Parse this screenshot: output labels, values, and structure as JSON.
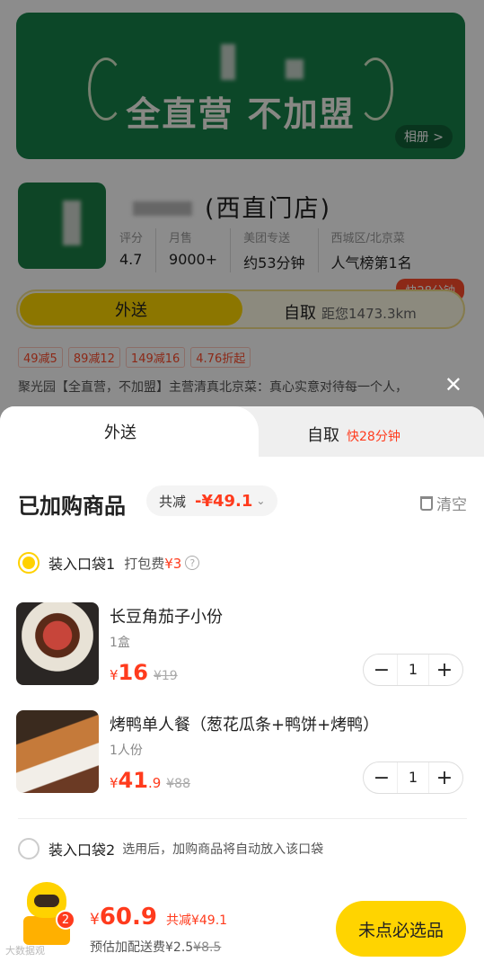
{
  "store": {
    "banner_slogan": "全直营 不加盟",
    "album_label": "相册 >",
    "name": "(西直门店)",
    "stats": [
      {
        "label": "评分",
        "value": "4.7"
      },
      {
        "label": "月售",
        "value": "9000+"
      },
      {
        "label": "美团专送",
        "value": "约53分钟"
      },
      {
        "label": "西城区/北京菜",
        "value": "人气榜第1名"
      }
    ],
    "mode_delivery": "外送",
    "mode_pickup": "自取",
    "pickup_distance": "距您1473.3km",
    "fast_badge": "快28分钟",
    "coupons": [
      "49减5",
      "89减12",
      "149减16",
      "4.76折起"
    ],
    "announcement": "聚光园【全直营，不加盟】主营清真北京菜：真心实意对待每一个人，"
  },
  "sheet": {
    "tab_delivery": "外送",
    "tab_pickup": "自取",
    "tab_pickup_badge": "快28分钟",
    "title": "已加购商品",
    "reduce_label": "共减",
    "reduce_value": "-¥49.1",
    "clear_label": "清空",
    "bag1": {
      "label": "装入口袋1",
      "fee_label": "打包费",
      "fee": "¥3"
    },
    "items": [
      {
        "name": "长豆角茄子小份",
        "spec": "1盒",
        "price_yen": "¥",
        "price_main": "16",
        "price_cents": "",
        "old_price": "¥19",
        "qty": "1"
      },
      {
        "name": "烤鸭单人餐（葱花瓜条+鸭饼+烤鸭）",
        "spec": "1人份",
        "price_yen": "¥",
        "price_main": "41",
        "price_cents": ".9",
        "old_price": "¥88",
        "qty": "1"
      }
    ],
    "bag2": {
      "label": "装入口袋2",
      "hint": "选用后，加购商品将自动放入该口袋"
    }
  },
  "bottom": {
    "badge_count": "2",
    "total_yen": "¥",
    "total_amount": "60.9",
    "saved": "共减¥49.1",
    "ship_label": "预估加配送费¥2.5",
    "ship_old": "¥8.5",
    "must_button": "未点必选品",
    "watermark": "大数据观"
  },
  "icons": {
    "close": "close-icon",
    "trash": "trash-icon",
    "info": "info-icon",
    "chevron": "chevron-down-icon",
    "minus": "minus-icon",
    "plus": "plus-icon"
  },
  "colors": {
    "accent_yellow": "#ffd400",
    "price_red": "#ff3b1d",
    "banner_green": "#17824a"
  }
}
